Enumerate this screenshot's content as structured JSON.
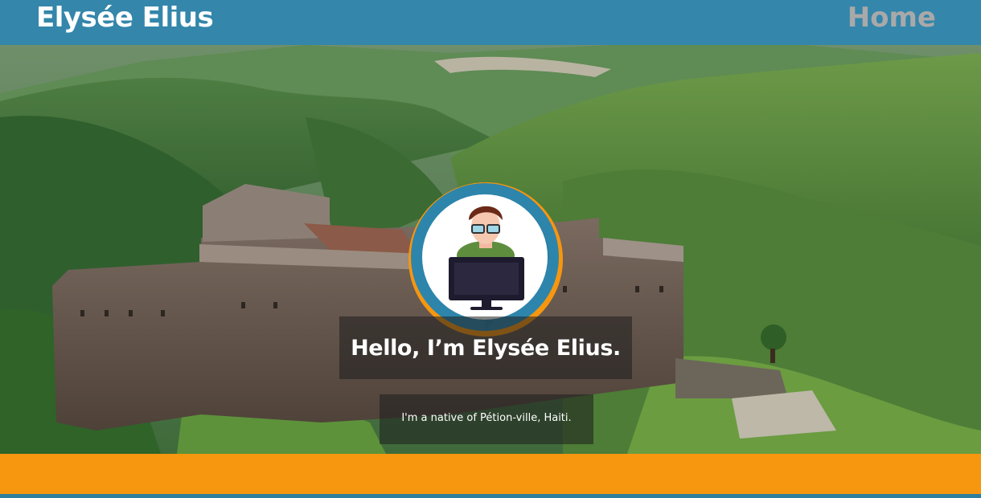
{
  "navbar": {
    "brand": "Elysée Elius",
    "home_link": "Home"
  },
  "hero": {
    "heading": "Hello, I’m Elysée Elius.",
    "subheading": "I'm a native of Pétion-ville, Haiti."
  },
  "colors": {
    "navbar": "#3486ab",
    "accent_orange": "#f7960f",
    "avatar_ring": "#2d85ab",
    "nav_link": "#a9a9a9"
  }
}
